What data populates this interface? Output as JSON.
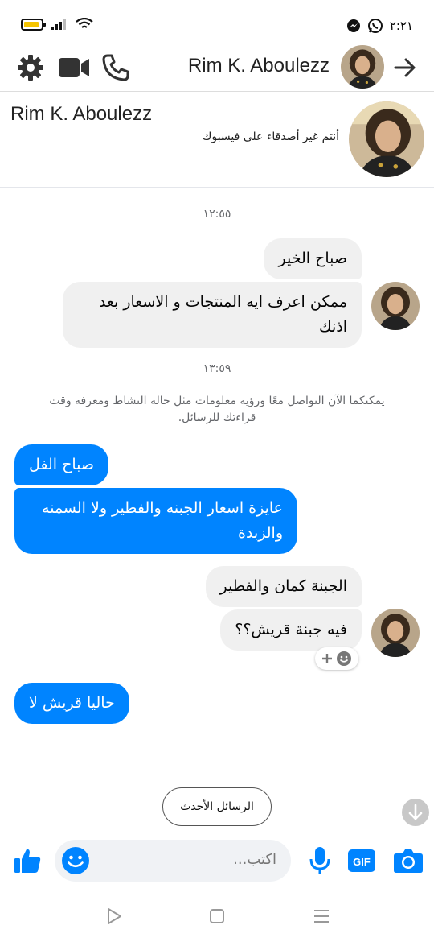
{
  "status_bar": {
    "time": "٢:٢١"
  },
  "header": {
    "contact_name": "Rim K. Aboulezz"
  },
  "profile": {
    "name": "Rim K. Aboulezz",
    "subtitle": "أنتم غير أصدقاء على فيسبوك"
  },
  "conversation": {
    "timestamp_1": "١٢:٥٥",
    "msg_1": "صباح الخير",
    "msg_2": "ممكن اعرف ايه المنتجات و الاسعار بعد اذنك",
    "timestamp_2": "١٣:٥٩",
    "info_notice": "يمكنكما الآن التواصل معًا ورؤية معلومات مثل حالة النشاط ومعرفة وقت قراءتك للرسائل.",
    "msg_3": "صباح الفل",
    "msg_4": "عايزة اسعار الجبنه والفطير ولا السمنه والزبدة",
    "msg_5": "الجبنة كمان والفطير",
    "msg_6": "فيه جبنة قريش؟؟",
    "msg_7": "حاليا قريش لا"
  },
  "newer_messages_button": "الرسائل الأحدث",
  "composer": {
    "placeholder": "اكتب..."
  },
  "colors": {
    "accent": "#0084ff",
    "incoming_bubble": "#f0f0f0"
  }
}
